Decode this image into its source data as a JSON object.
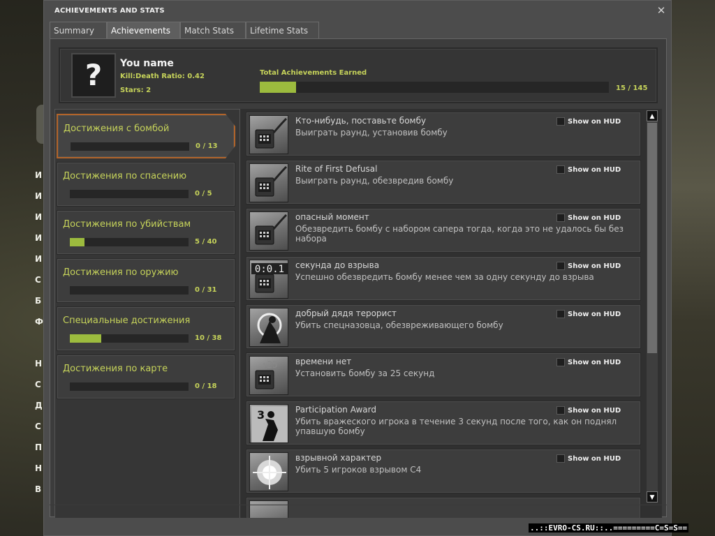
{
  "window": {
    "title": "ACHIEVEMENTS AND STATS",
    "close_glyph": "✕"
  },
  "tabs": [
    {
      "label": "Summary",
      "active": false
    },
    {
      "label": "Achievements",
      "active": true
    },
    {
      "label": "Match Stats",
      "active": false
    },
    {
      "label": "Lifetime Stats",
      "active": false
    }
  ],
  "player": {
    "avatar_glyph": "?",
    "name": "You name",
    "kd": "Kill:Death Ratio: 0.42",
    "stars": "Stars: 2",
    "total_label": "Total Achievements Earned",
    "total_count": "15 / 145",
    "total_fraction": 0.103
  },
  "categories": [
    {
      "label": "Достижения с бомбой",
      "count": "0 / 13",
      "fraction": 0,
      "active": true
    },
    {
      "label": "Достижения по спасению",
      "count": "0 / 5",
      "fraction": 0,
      "active": false
    },
    {
      "label": "Достижения по убийствам",
      "count": "5 / 40",
      "fraction": 0.125,
      "active": false
    },
    {
      "label": "Достижения по оружию",
      "count": "0 / 31",
      "fraction": 0,
      "active": false
    },
    {
      "label": "Специальные достижения",
      "count": "10 / 38",
      "fraction": 0.263,
      "active": false
    },
    {
      "label": "Достижения по карте",
      "count": "0 / 18",
      "fraction": 0,
      "active": false
    }
  ],
  "hud_label": "Show on HUD",
  "achievements": [
    {
      "title": "Кто-нибудь, поставьте бомбу",
      "desc": "Выиграть раунд, установив бомбу",
      "icon": "c4-plant-icon"
    },
    {
      "title": "Rite of First Defusal",
      "desc": "Выиграть раунд, обезвредив бомбу",
      "icon": "c4-defuse-icon"
    },
    {
      "title": "опасный момент",
      "desc": "Обезвредить бомбу с набором сапера тогда, когда это не удалось бы без набора",
      "icon": "defuse-kit-icon"
    },
    {
      "title": "секунда до взрыва",
      "desc": "Успешно обезвредить бомбу менее чем за одну секунду до взрыва",
      "icon": "timer-001-icon"
    },
    {
      "title": "добрый дядя терорист",
      "desc": "Убить спецназовца, обезвреживающего бомбу",
      "icon": "kill-defuser-icon"
    },
    {
      "title": "времени нет",
      "desc": "Установить бомбу за 25 секунд",
      "icon": "timer-25-icon"
    },
    {
      "title": "Participation Award",
      "desc": "Убить вражеского игрока в течение 3 секунд после того, как он поднял упавшую бомбу",
      "icon": "pickup-kill-icon"
    },
    {
      "title": "взрывной характер",
      "desc": "Убить 5 игроков взрывом C4",
      "icon": "c4-explosion-icon"
    },
    {
      "title": "",
      "desc": "",
      "icon": "partial-icon"
    }
  ],
  "background_menu": [
    "И",
    "И",
    "И",
    "И",
    "И",
    "С",
    "Б",
    "Ф",
    "",
    "Н",
    "С",
    "Д",
    "С",
    "П",
    "Н",
    "В"
  ],
  "watermark": "..::EVRO-CS.RU::..=========C=S=S=="
}
